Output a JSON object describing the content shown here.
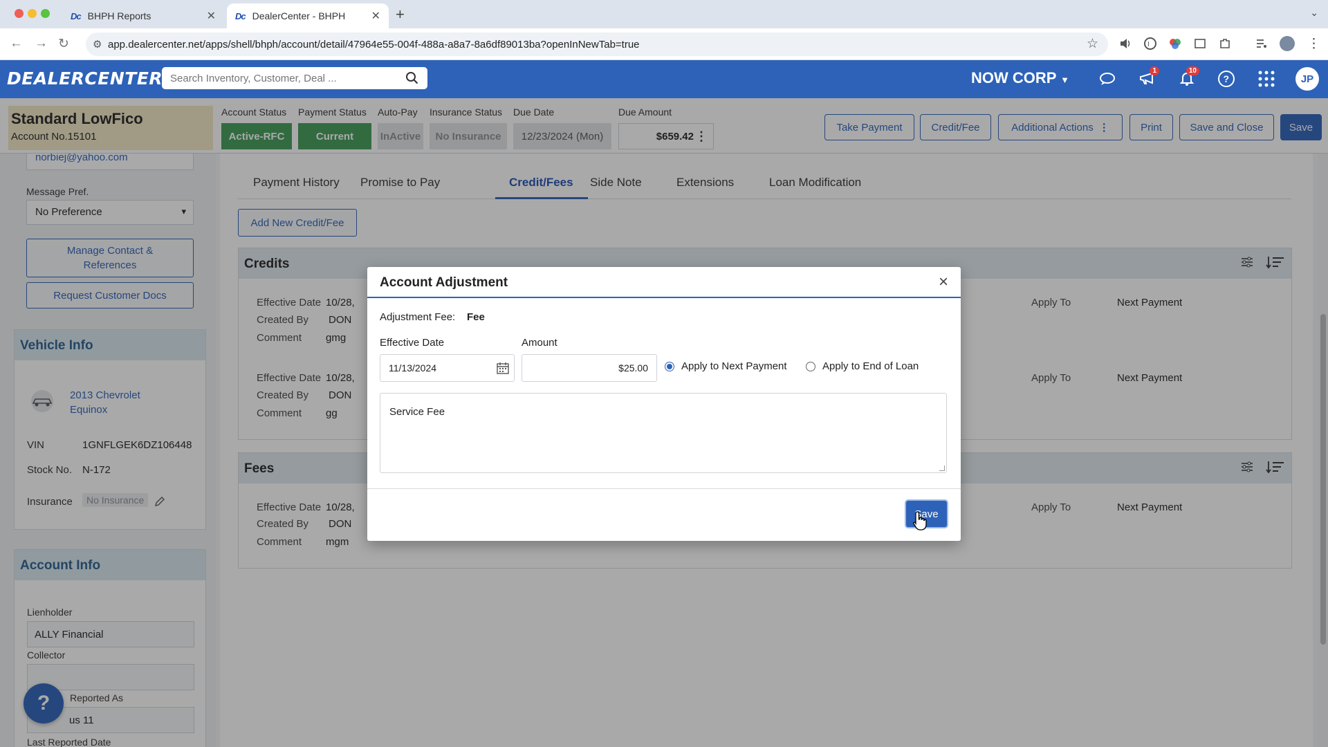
{
  "browser": {
    "tabs": [
      {
        "favicon": "Dc",
        "title": "BHPH Reports"
      },
      {
        "favicon": "Dc",
        "title": "DealerCenter - BHPH"
      }
    ],
    "url": "app.dealercenter.net/apps/shell/bhph/account/detail/47964e55-004f-488a-a8a7-8a6df89013ba?openInNewTab=true"
  },
  "header": {
    "logo": "DEALERCENTER",
    "search_placeholder": "Search Inventory, Customer, Deal ...",
    "company": "NOW CORP",
    "notif_badge_1": "1",
    "notif_badge_2": "10",
    "avatar": "JP",
    "colors": {
      "brand": "#2d62b8",
      "active_green": "#3f9b56",
      "badge_red": "#e23b3b"
    }
  },
  "account": {
    "name": "Standard LowFico",
    "number_label": "Account No.",
    "number": "15101",
    "labels": {
      "account_status": "Account Status",
      "payment_status": "Payment Status",
      "auto_pay": "Auto-Pay",
      "insurance_status": "Insurance Status",
      "due_date": "Due Date",
      "due_amount": "Due Amount"
    },
    "values": {
      "account_status": "Active-RFC",
      "payment_status": "Current",
      "auto_pay": "InActive",
      "insurance_status": "No Insurance",
      "due_date": "12/23/2024 (Mon)",
      "due_amount": "$659.42"
    },
    "actions": {
      "take_payment": "Take Payment",
      "credit_fee": "Credit/Fee",
      "additional_actions": "Additional Actions",
      "print": "Print",
      "save_and_close": "Save and Close",
      "save": "Save"
    }
  },
  "sidebar": {
    "email": "norbiej@yahoo.com",
    "message_pref_label": "Message Pref.",
    "message_pref_value": "No Preference",
    "manage_contact": "Manage Contact & References",
    "request_docs": "Request Customer Docs",
    "vehicle_info": {
      "title": "Vehicle Info",
      "vehicle_name": "2013 Chevrolet Equinox",
      "vin_label": "VIN",
      "vin": "1GNFLGEK6DZ106448",
      "stock_label": "Stock No.",
      "stock": "N-172",
      "insurance_label": "Insurance",
      "insurance": "No Insurance"
    },
    "account_info": {
      "title": "Account Info",
      "lienholder_label": "Lienholder",
      "lienholder": "ALLY Financial",
      "collector_label": "Collector",
      "collector": "",
      "reported_as_label": "Reported As",
      "reported_as": "us 11",
      "last_reported_label": "Last Reported Date"
    },
    "help": "?"
  },
  "main": {
    "tabs": [
      "Payment History",
      "Promise to Pay",
      "Credit/Fees",
      "Side Note",
      "Extensions",
      "Loan Modification"
    ],
    "active_tab": "Credit/Fees",
    "add_button": "Add New Credit/Fee",
    "credits": {
      "title": "Credits",
      "rows": [
        {
          "effective_label": "Effective Date",
          "effective": "10/28,",
          "created_label": "Created By",
          "created": "DON",
          "comment_label": "Comment",
          "comment": "gmg",
          "apply_label": "Apply To",
          "apply": "Next Payment"
        },
        {
          "effective_label": "Effective Date",
          "effective": "10/28,",
          "created_label": "Created By",
          "created": "DON",
          "comment_label": "Comment",
          "comment": "gg",
          "apply_label": "Apply To",
          "apply": "Next Payment"
        }
      ]
    },
    "fees": {
      "title": "Fees",
      "rows": [
        {
          "effective_label": "Effective Date",
          "effective": "10/28,",
          "created_label": "Created By",
          "created": "DON",
          "comment_label": "Comment",
          "comment": "mgm",
          "apply_label": "Apply To",
          "apply": "Next Payment"
        }
      ]
    }
  },
  "modal": {
    "title": "Account Adjustment",
    "close": "×",
    "adjustment_label": "Adjustment Fee:",
    "adjustment_value": "Fee",
    "effective_date_label": "Effective Date",
    "effective_date": "11/13/2024",
    "amount_label": "Amount",
    "amount": "$25.00",
    "apply_next": "Apply to Next Payment",
    "apply_end": "Apply to End of Loan",
    "selected_option": "Apply to Next Payment",
    "comment": "Service Fee",
    "save": "Save"
  }
}
